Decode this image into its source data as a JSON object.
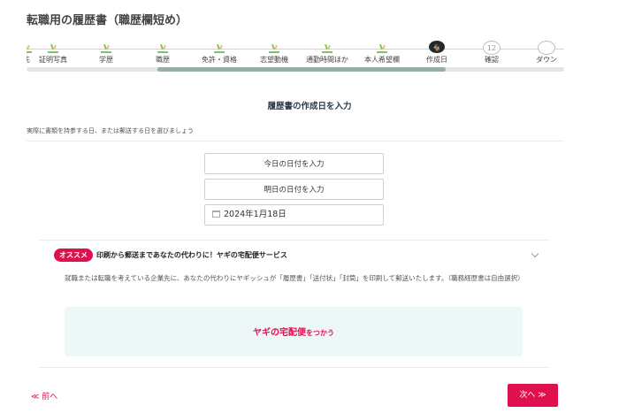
{
  "page": {
    "title": "転職用の履歴書（職歴欄短め）"
  },
  "steps": [
    {
      "label": "先",
      "status": "done"
    },
    {
      "label": "証明写真",
      "status": "done"
    },
    {
      "label": "学歴",
      "status": "done"
    },
    {
      "label": "職歴",
      "status": "done"
    },
    {
      "label": "免許・資格",
      "status": "done"
    },
    {
      "label": "志望動機",
      "status": "done"
    },
    {
      "label": "通勤時間ほか",
      "status": "done"
    },
    {
      "label": "本人希望欄",
      "status": "done"
    },
    {
      "label": "作成日",
      "status": "current"
    },
    {
      "label": "確認",
      "status": "future",
      "number": "12"
    },
    {
      "label": "ダウン",
      "status": "future",
      "number": ""
    }
  ],
  "progress": {
    "percent_fill": 78
  },
  "section": {
    "title": "履歴書の作成日を入力",
    "subtitle": "実際に書類を持参する日、または郵送する日を選びましょう"
  },
  "date_buttons": {
    "today": "今日の日付を入力",
    "tomorrow": "明日の日付を入力"
  },
  "date_input": {
    "value": "2024年1月18日"
  },
  "promo": {
    "badge": "オススメ",
    "title": "印刷から郵送まであなたの代わりに！ヤギの宅配便サービス",
    "description": "就職または転職を考えている企業先に、あなたの代わりにヤギッシュが「履歴書」「送付状」「封筒」を印刷して郵送いたします。（職務経歴書は自由選択）",
    "cta_main": "ヤギの宅配便",
    "cta_small": "をつかう"
  },
  "nav": {
    "prev": "≪ 前へ",
    "next": "次へ ≫"
  },
  "colors": {
    "accent": "#e0104f",
    "current_step": "#1f2d2a",
    "done_step": "#7cc36a"
  }
}
